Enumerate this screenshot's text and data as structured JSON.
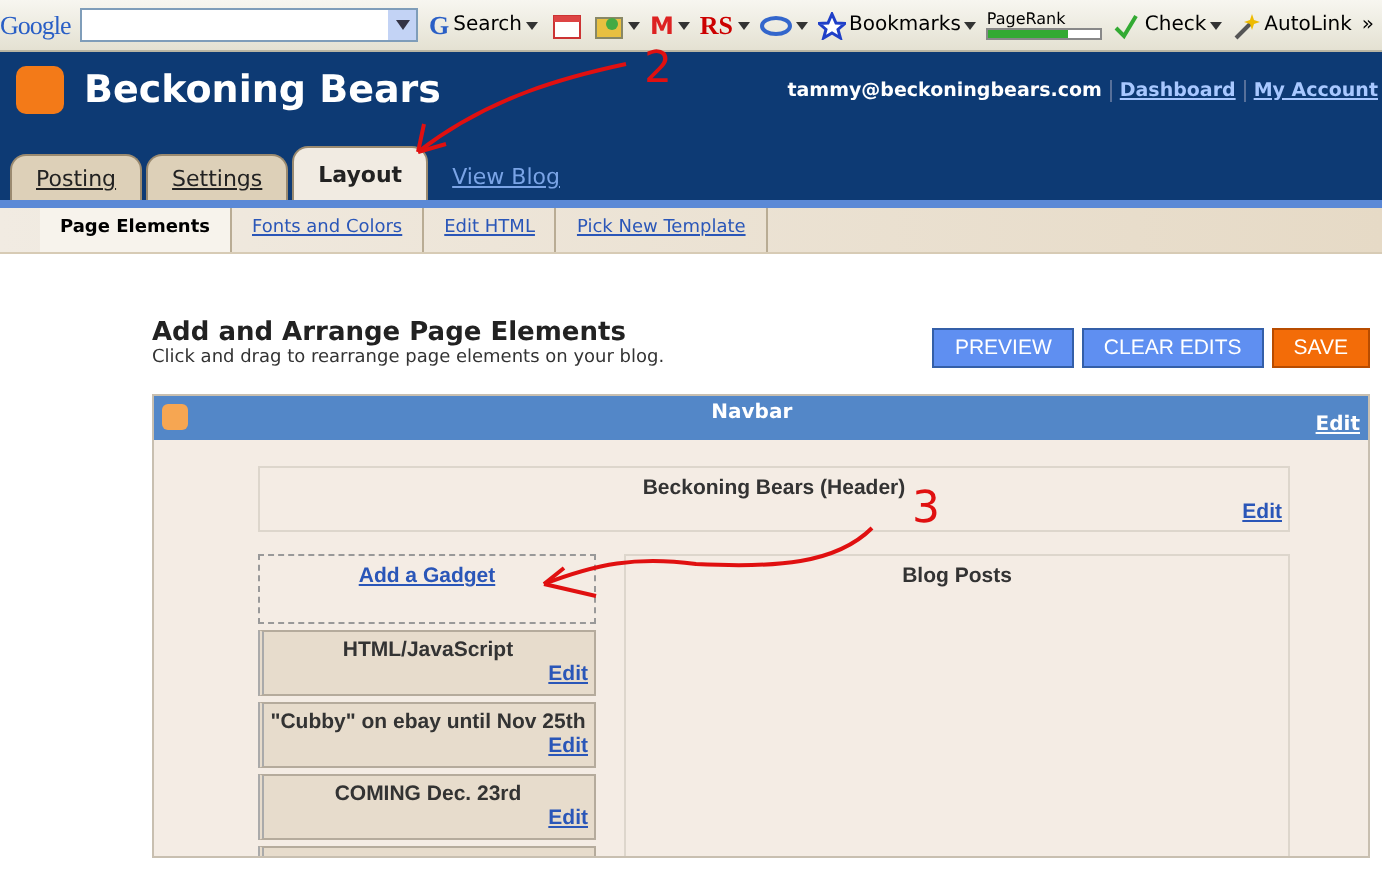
{
  "toolbar": {
    "logo": "Google",
    "search_letter": "G",
    "search_button": "Search",
    "mail_button": "M",
    "rs_button": "RS",
    "bookmarks_button": "Bookmarks",
    "pagerank": {
      "label": "PageRank",
      "level": 0.7
    },
    "check_button": "Check",
    "autolink_button": "AutoLink",
    "more_button": "»"
  },
  "header": {
    "blog_title": "Beckoning Bears",
    "user": "tammy@beckoningbears.com",
    "links": [
      "Dashboard",
      "My Account"
    ]
  },
  "tabs": [
    {
      "label": "Posting",
      "selected": false
    },
    {
      "label": "Settings",
      "selected": false
    },
    {
      "label": "Layout",
      "selected": true
    }
  ],
  "view_blog_link": "View Blog",
  "subtabs": [
    {
      "label": "Page Elements",
      "selected": true
    },
    {
      "label": "Fonts and Colors",
      "selected": false
    },
    {
      "label": "Edit HTML",
      "selected": false
    },
    {
      "label": "Pick New Template",
      "selected": false
    }
  ],
  "page": {
    "title": "Add and Arrange Page Elements",
    "subtitle": "Click and drag to rearrange page elements on your blog."
  },
  "buttons": [
    {
      "kind": "preview",
      "label": "PREVIEW"
    },
    {
      "kind": "clear",
      "label": "CLEAR EDITS"
    },
    {
      "kind": "save",
      "label": "SAVE"
    }
  ],
  "navbar": {
    "title": "Navbar",
    "edit": "Edit"
  },
  "header_widget": {
    "title": "Beckoning Bears (Header)",
    "edit": "Edit"
  },
  "add_gadget": "Add a Gadget",
  "sidebar_widgets": [
    {
      "kind": "widget",
      "title": "HTML/JavaScript",
      "edit": "Edit"
    },
    {
      "kind": "widget",
      "title": "\"Cubby\" on ebay until Nov 25th",
      "edit": "Edit"
    },
    {
      "kind": "widget",
      "title": "COMING Dec. 23rd",
      "edit": "Edit"
    },
    {
      "kind": "cut-off"
    }
  ],
  "blog_posts": {
    "title": "Blog Posts"
  },
  "annotations": [
    {
      "label": "2"
    },
    {
      "label": "3"
    }
  ]
}
